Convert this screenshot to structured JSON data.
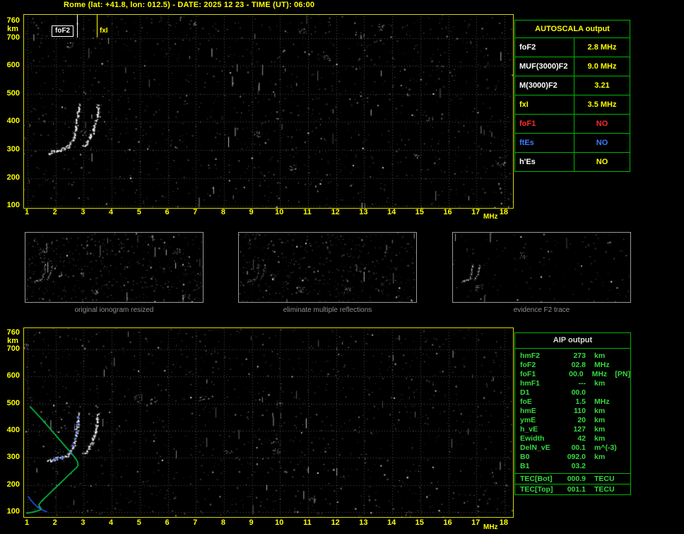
{
  "header": {
    "title": "Rome (lat: +41.8, lon: 012.5) - DATE: 2025 12 23 - TIME (UT): 06:00"
  },
  "top_plot": {
    "y_unit": "km",
    "x_unit": "MHz",
    "y_ticks": [
      "760",
      "700",
      "600",
      "500",
      "400",
      "300",
      "200",
      "100"
    ],
    "x_ticks": [
      "1",
      "2",
      "3",
      "4",
      "5",
      "6",
      "7",
      "8",
      "9",
      "10",
      "11",
      "12",
      "13",
      "14",
      "15",
      "16",
      "17",
      "18"
    ],
    "fof2_marker": {
      "label": "foF2",
      "freq_mhz": 2.8
    },
    "fxi_marker": {
      "label": "fxI",
      "freq_mhz": 3.5
    },
    "traces": {
      "o_mode": [
        [
          1.7,
          290
        ],
        [
          1.85,
          294
        ],
        [
          2.0,
          298
        ],
        [
          2.15,
          302
        ],
        [
          2.3,
          307
        ],
        [
          2.45,
          314
        ],
        [
          2.55,
          327
        ],
        [
          2.63,
          345
        ],
        [
          2.69,
          369
        ],
        [
          2.74,
          396
        ],
        [
          2.77,
          424
        ],
        [
          2.8,
          452
        ],
        [
          2.81,
          466
        ]
      ],
      "x_mode": [
        [
          2.98,
          314
        ],
        [
          3.1,
          328
        ],
        [
          3.2,
          343
        ],
        [
          3.3,
          361
        ],
        [
          3.37,
          384
        ],
        [
          3.43,
          410
        ],
        [
          3.47,
          437
        ],
        [
          3.5,
          463
        ]
      ]
    }
  },
  "autoscala_table": {
    "title": "AUTOSCALA output",
    "rows": [
      {
        "label": "foF2",
        "value": "2.8 MHz",
        "label_color": "#ffffff",
        "value_color": "#ffff00"
      },
      {
        "label": "MUF(3000)F2",
        "value": "9.0 MHz",
        "label_color": "#ffffff",
        "value_color": "#ffff00"
      },
      {
        "label": "M(3000)F2",
        "value": "3.21",
        "label_color": "#ffffff",
        "value_color": "#ffff00"
      },
      {
        "label": "fxI",
        "value": "3.5 MHz",
        "label_color": "#ffff00",
        "value_color": "#ffff00"
      },
      {
        "label": "foF1",
        "value": "NO",
        "label_color": "#ff2a2a",
        "value_color": "#ff2a2a"
      },
      {
        "label": "ftEs",
        "value": "NO",
        "label_color": "#3d7bff",
        "value_color": "#3d7bff"
      },
      {
        "label": "h'Es",
        "value": "NO",
        "label_color": "#ffffff",
        "value_color": "#ffff00"
      }
    ]
  },
  "thumbnails": [
    {
      "caption": "original ionogram resized"
    },
    {
      "caption": "eliminate multiple reflections"
    },
    {
      "caption": "evidence F2 trace"
    }
  ],
  "bottom_plot": {
    "y_unit": "km",
    "x_unit": "MHz",
    "y_ticks": [
      "760",
      "700",
      "600",
      "500",
      "400",
      "300",
      "200",
      "100"
    ],
    "x_ticks": [
      "1",
      "2",
      "3",
      "4",
      "5",
      "6",
      "7",
      "8",
      "9",
      "10",
      "11",
      "12",
      "13",
      "14",
      "15",
      "16",
      "17",
      "18"
    ],
    "traces": {
      "o_mode": [
        [
          1.7,
          290
        ],
        [
          1.85,
          294
        ],
        [
          2.0,
          298
        ],
        [
          2.15,
          302
        ],
        [
          2.3,
          307
        ],
        [
          2.45,
          314
        ],
        [
          2.55,
          327
        ],
        [
          2.63,
          345
        ],
        [
          2.69,
          369
        ],
        [
          2.74,
          396
        ],
        [
          2.77,
          424
        ],
        [
          2.8,
          452
        ],
        [
          2.81,
          466
        ]
      ],
      "x_mode": [
        [
          2.98,
          314
        ],
        [
          3.1,
          328
        ],
        [
          3.2,
          343
        ],
        [
          3.3,
          361
        ],
        [
          3.37,
          384
        ],
        [
          3.43,
          410
        ],
        [
          3.47,
          437
        ],
        [
          3.5,
          463
        ]
      ]
    },
    "profile_green": [
      [
        0.95,
        96
      ],
      [
        1.2,
        100
      ],
      [
        1.38,
        105
      ],
      [
        1.5,
        110
      ],
      [
        1.44,
        118
      ],
      [
        1.4,
        127
      ],
      [
        1.52,
        142
      ],
      [
        1.7,
        160
      ],
      [
        1.9,
        180
      ],
      [
        2.12,
        202
      ],
      [
        2.32,
        222
      ],
      [
        2.5,
        240
      ],
      [
        2.64,
        254
      ],
      [
        2.75,
        264
      ],
      [
        2.8,
        273
      ],
      [
        2.78,
        286
      ],
      [
        2.68,
        302
      ],
      [
        2.52,
        322
      ],
      [
        2.3,
        348
      ],
      [
        2.05,
        378
      ],
      [
        1.8,
        408
      ],
      [
        1.55,
        438
      ],
      [
        1.3,
        466
      ],
      [
        1.08,
        490
      ]
    ],
    "e_profile_blue": [
      [
        1.02,
        158
      ],
      [
        1.1,
        146
      ],
      [
        1.2,
        134
      ],
      [
        1.33,
        121
      ],
      [
        1.47,
        111
      ],
      [
        1.58,
        105
      ],
      [
        1.7,
        101
      ]
    ],
    "fitted_points_blue": [
      [
        1.9,
        297
      ],
      [
        2.05,
        300
      ],
      [
        2.2,
        304
      ],
      [
        2.5,
        320
      ],
      [
        2.6,
        345
      ],
      [
        2.67,
        372
      ],
      [
        2.72,
        398
      ],
      [
        2.76,
        426
      ],
      [
        2.79,
        452
      ]
    ]
  },
  "aip_table": {
    "title": "AIP output",
    "rows": [
      {
        "label": "hmF2",
        "value": "273",
        "unit": "km",
        "note": ""
      },
      {
        "label": "foF2",
        "value": "02.8",
        "unit": "MHz",
        "note": ""
      },
      {
        "label": "foF1",
        "value": "00.0",
        "unit": "MHz",
        "note": "[PN]"
      },
      {
        "label": "hmF1",
        "value": "---",
        "unit": "km",
        "note": ""
      },
      {
        "label": "D1",
        "value": "00.0",
        "unit": "",
        "note": ""
      },
      {
        "label": "foE",
        "value": "1.5",
        "unit": "MHz",
        "note": ""
      },
      {
        "label": "hmE",
        "value": "110",
        "unit": "km",
        "note": ""
      },
      {
        "label": "ymE",
        "value": "20",
        "unit": "km",
        "note": ""
      },
      {
        "label": "h_vE",
        "value": "127",
        "unit": "km",
        "note": ""
      },
      {
        "label": "Ewidth",
        "value": "42",
        "unit": "km",
        "note": ""
      },
      {
        "label": "DelN_vE",
        "value": "00.1",
        "unit": "m^(-3)",
        "note": ""
      },
      {
        "label": "B0",
        "value": "092.0",
        "unit": "km",
        "note": ""
      },
      {
        "label": "B1",
        "value": "03.2",
        "unit": "",
        "note": ""
      }
    ],
    "tec_rows": [
      {
        "label": "TEC[Bot]",
        "value": "000.9",
        "unit": "TECU"
      },
      {
        "label": "TEC[Top]",
        "value": "001.1",
        "unit": "TECU"
      }
    ]
  },
  "colors": {
    "axis_yellow": "#ffff00",
    "table_green": "#00b400",
    "status_red": "#ff2a2a",
    "status_blue": "#3d7bff",
    "profile_green": "#00d944",
    "trace_white": "#ffffff",
    "caption_gray": "#8f8f8f"
  }
}
